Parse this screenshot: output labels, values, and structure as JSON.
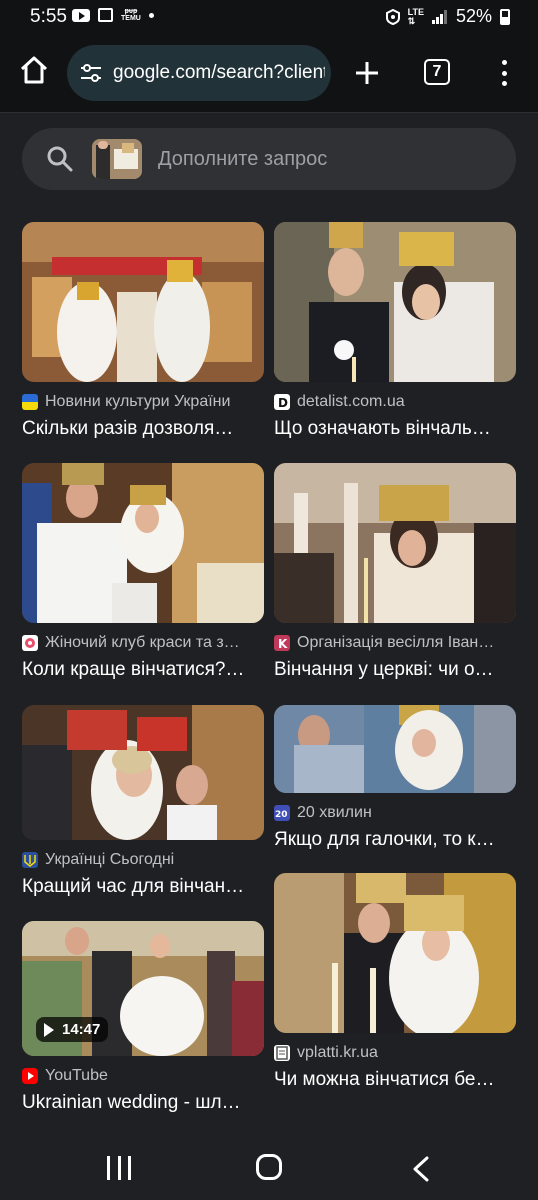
{
  "status_bar": {
    "time": "5:55",
    "temu_line1": "ᵽᵾᵽ",
    "temu_line2": "TEMU",
    "network": "LTE",
    "battery": "52%"
  },
  "toolbar": {
    "url": "google.com/search?client",
    "tab_count": "7"
  },
  "search": {
    "placeholder": "Дополните запрос"
  },
  "results": [
    {
      "source": "Новини культури України",
      "title": "Скільки разів дозволя…",
      "favicon": "ukraine-flag-icon"
    },
    {
      "source": "detalist.com.ua",
      "title": "Що означають вінчаль…",
      "favicon": "detalist-icon"
    },
    {
      "source": "Жіночий клуб краси та з…",
      "title": "Коли краще вінчатися?…",
      "favicon": "flower-icon"
    },
    {
      "source": "Організація весілля Іван…",
      "title": "Вінчання у церкві: чи о…",
      "favicon": "k-icon"
    },
    {
      "source": "Українці Сьогодні",
      "title": "Кращий час для вінчан…",
      "favicon": "trident-icon"
    },
    {
      "source": "20 хвилин",
      "title": "Якщо для галочки, то к…",
      "favicon": "20-icon"
    },
    {
      "source": "YouTube",
      "title": "Ukrainian wedding - шл…",
      "favicon": "youtube-icon",
      "duration": "14:47"
    },
    {
      "source": "vplatti.kr.ua",
      "title": "Чи можна вінчатися бе…",
      "favicon": "document-icon"
    }
  ],
  "colors": {
    "background": "#1f2023",
    "url_bar": "#223239",
    "search_box": "#303134"
  }
}
